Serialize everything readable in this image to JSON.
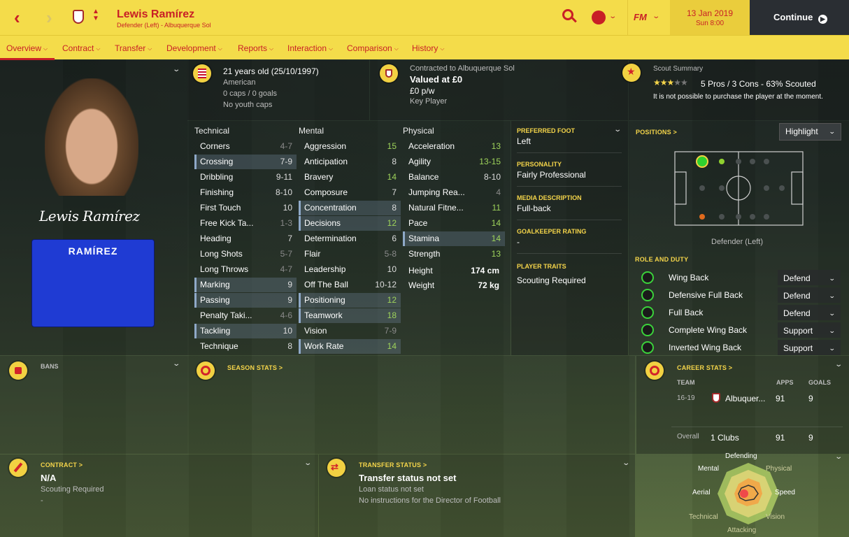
{
  "header": {
    "player_name": "Lewis Ramírez",
    "player_sub": "Defender (Left) - Albuquerque Sol",
    "date": "13 Jan 2019",
    "time": "Sun 8:00",
    "continue_label": "Continue",
    "fm_label": "FM"
  },
  "nav": [
    "Overview",
    "Contract",
    "Transfer",
    "Development",
    "Reports",
    "Interaction",
    "Comparison",
    "History"
  ],
  "profile": {
    "signature": "Lewis Ramírez",
    "shirt_name": "RAMÍREZ"
  },
  "bio": {
    "age": "21 years old (25/10/1997)",
    "nationality": "American",
    "caps": "0 caps / 0 goals",
    "youth": "No youth caps"
  },
  "contract_summary": {
    "contracted": "Contracted to Albuquerque Sol",
    "value": "Valued at £0",
    "wage": "£0 p/w",
    "role": "Key Player"
  },
  "scout": {
    "title": "Scout Summary",
    "rating": "5 Pros / 3 Cons - 63% Scouted",
    "note": "It is not possible to purchase the player at the moment.",
    "stars": 3.5
  },
  "attr_headers": {
    "technical": "Technical",
    "mental": "Mental",
    "physical": "Physical"
  },
  "technical": [
    [
      "Corners",
      "4-7"
    ],
    [
      "Crossing",
      "7-9"
    ],
    [
      "Dribbling",
      "9-11"
    ],
    [
      "Finishing",
      "8-10"
    ],
    [
      "First Touch",
      "10"
    ],
    [
      "Free Kick Ta...",
      "1-3"
    ],
    [
      "Heading",
      "7"
    ],
    [
      "Long Shots",
      "5-7"
    ],
    [
      "Long Throws",
      "4-7"
    ],
    [
      "Marking",
      "9"
    ],
    [
      "Passing",
      "9"
    ],
    [
      "Penalty Taki...",
      "4-6"
    ],
    [
      "Tackling",
      "10"
    ],
    [
      "Technique",
      "8"
    ]
  ],
  "mental": [
    [
      "Aggression",
      "15"
    ],
    [
      "Anticipation",
      "8"
    ],
    [
      "Bravery",
      "14"
    ],
    [
      "Composure",
      "7"
    ],
    [
      "Concentration",
      "8"
    ],
    [
      "Decisions",
      "12"
    ],
    [
      "Determination",
      "6"
    ],
    [
      "Flair",
      "5-8"
    ],
    [
      "Leadership",
      "10"
    ],
    [
      "Off The Ball",
      "10-12"
    ],
    [
      "Positioning",
      "12"
    ],
    [
      "Teamwork",
      "18"
    ],
    [
      "Vision",
      "7-9"
    ],
    [
      "Work Rate",
      "14"
    ]
  ],
  "physical": [
    [
      "Acceleration",
      "13"
    ],
    [
      "Agility",
      "13-15"
    ],
    [
      "Balance",
      "8-10"
    ],
    [
      "Jumping Rea...",
      "4"
    ],
    [
      "Natural Fitne...",
      "11"
    ],
    [
      "Pace",
      "14"
    ],
    [
      "Stamina",
      "14"
    ],
    [
      "Strength",
      "13"
    ]
  ],
  "body": {
    "height_label": "Height",
    "height": "174 cm",
    "weight_label": "Weight",
    "weight": "72 kg"
  },
  "info": {
    "foot_h": "PREFERRED FOOT",
    "foot": "Left",
    "pers_h": "PERSONALITY",
    "pers": "Fairly Professional",
    "media_h": "MEDIA DESCRIPTION",
    "media": "Full-back",
    "gk_h": "GOALKEEPER RATING",
    "gk": "-",
    "traits_h": "PLAYER TRAITS",
    "traits": "Scouting Required"
  },
  "positions": {
    "title": "POSITIONS >",
    "dropdown": "Highlight",
    "position_label": "Defender (Left)"
  },
  "roles": {
    "title": "ROLE AND DUTY",
    "items": [
      [
        "Wing Back",
        "Defend"
      ],
      [
        "Defensive Full Back",
        "Defend"
      ],
      [
        "Full Back",
        "Defend"
      ],
      [
        "Complete Wing Back",
        "Support"
      ],
      [
        "Inverted Wing Back",
        "Support"
      ]
    ]
  },
  "bans": {
    "title": "BANS"
  },
  "season": {
    "title": "SEASON STATS >"
  },
  "career": {
    "title": "CAREER STATS >",
    "h_team": "TEAM",
    "h_apps": "APPS",
    "h_goals": "GOALS",
    "season": "16-19",
    "club": "Albuquer...",
    "apps": "91",
    "goals": "9",
    "overall": "Overall",
    "clubs": "1 Clubs",
    "o_apps": "91",
    "o_goals": "9"
  },
  "contract": {
    "title": "CONTRACT >",
    "status": "N/A",
    "sub": "Scouting Required",
    "dash": "-"
  },
  "transfer": {
    "title": "TRANSFER STATUS >",
    "status": "Transfer status not set",
    "loan": "Loan status not set",
    "dof": "No instructions for the Director of Football"
  },
  "radar": {
    "labels": [
      "Defending",
      "Physical",
      "Speed",
      "Vision",
      "Attacking",
      "Technical",
      "Aerial",
      "Mental"
    ]
  }
}
